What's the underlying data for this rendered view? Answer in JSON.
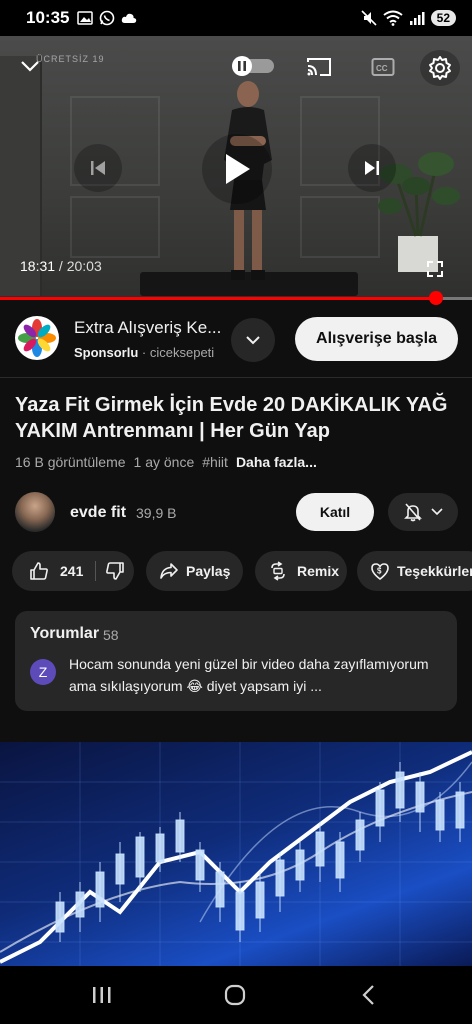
{
  "status_bar": {
    "time": "10:35",
    "battery": "52"
  },
  "video": {
    "brand_tag": "ÜCRETSİZ 19",
    "current_time": "18:31",
    "separator": " / ",
    "duration": "20:03",
    "progress": 0.923
  },
  "ad": {
    "title": "Extra Alışveriş Ke...",
    "sponsored": "Sponsorlu",
    "dot": "·",
    "domain": "ciceksepeti",
    "cta": "Alışverişe başla"
  },
  "title": "Yaza Fit Girmek İçin Evde 20 DAKİKALIK YAĞ YAKIM Antrenmanı | Her Gün Yap",
  "meta": {
    "views": "16 B görüntüleme",
    "age": "1 ay önce",
    "hashtag": "#hiit",
    "more": "Daha fazla..."
  },
  "channel": {
    "name": "evde fit",
    "subscribers": "39,9 B",
    "join_label": "Katıl"
  },
  "actions": {
    "likes": "241",
    "share": "Paylaş",
    "remix": "Remix",
    "thanks": "Teşekkürler"
  },
  "comments": {
    "title": "Yorumlar",
    "count": "58",
    "avatar_letter": "Z",
    "text": "Hocam sonunda yeni güzel bir video daha zayıflamıyorum ama sıkılaşıyorum 😂 diyet yapsam iyi ..."
  },
  "colors": {
    "background": "#0f0f0f",
    "surface": "#272727",
    "accent": "#ff0000",
    "text_primary": "#f1f1f1",
    "text_secondary": "#aaaaaa"
  }
}
